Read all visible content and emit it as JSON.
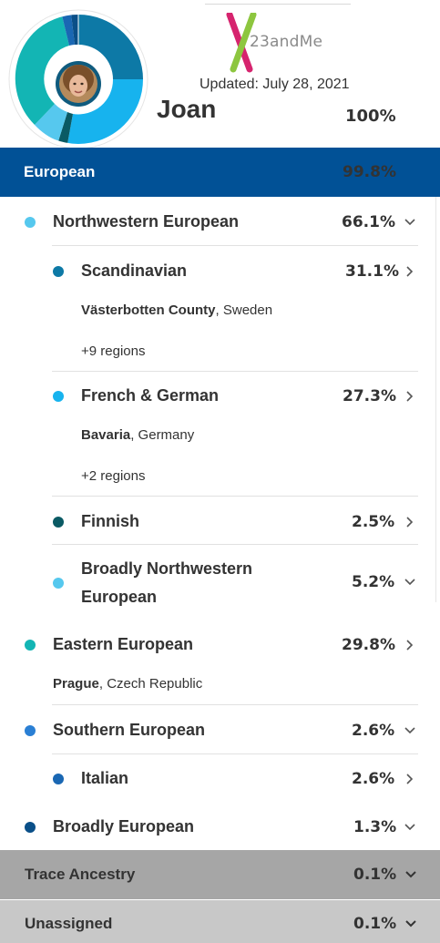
{
  "header": {
    "logo_text": "23andMe",
    "updated": "Updated: July 28, 2021",
    "name": "Joan",
    "total_pct": "100%"
  },
  "colors": {
    "banner": "#015196",
    "northwestern": "#56c8ee",
    "scandinavian": "#0d79a6",
    "french_german": "#17b3ee",
    "finnish": "#0a5a64",
    "eastern": "#13b5b4",
    "southern": "#2a7fd4",
    "italian": "#1a67b3",
    "broadly_european": "#0a4f88"
  },
  "banner": {
    "label": "European",
    "pct": "99.8%"
  },
  "rows": {
    "nw": {
      "label": "Northwestern European",
      "pct": "66.1%"
    },
    "scand": {
      "label": "Scandinavian",
      "pct": "31.1%",
      "region_bold": "Västerbotten County",
      "region_rest": ", Sweden",
      "more": "+9 regions"
    },
    "fg": {
      "label": "French & German",
      "pct": "27.3%",
      "region_bold": "Bavaria",
      "region_rest": ", Germany",
      "more": "+2 regions"
    },
    "finnish": {
      "label": "Finnish",
      "pct": "2.5%"
    },
    "bnw": {
      "label_line1": "Broadly Northwestern",
      "label_line2": "European",
      "pct": "5.2%"
    },
    "eastern": {
      "label": "Eastern European",
      "pct": "29.8%",
      "region_bold": "Prague",
      "region_rest": ", Czech Republic"
    },
    "southern": {
      "label": "Southern European",
      "pct": "2.6%"
    },
    "italian": {
      "label": "Italian",
      "pct": "2.6%"
    },
    "broadly": {
      "label": "Broadly European",
      "pct": "1.3%"
    }
  },
  "trace": {
    "label": "Trace Ancestry",
    "pct": "0.1%"
  },
  "unassigned": {
    "label": "Unassigned",
    "pct": "0.1%"
  }
}
